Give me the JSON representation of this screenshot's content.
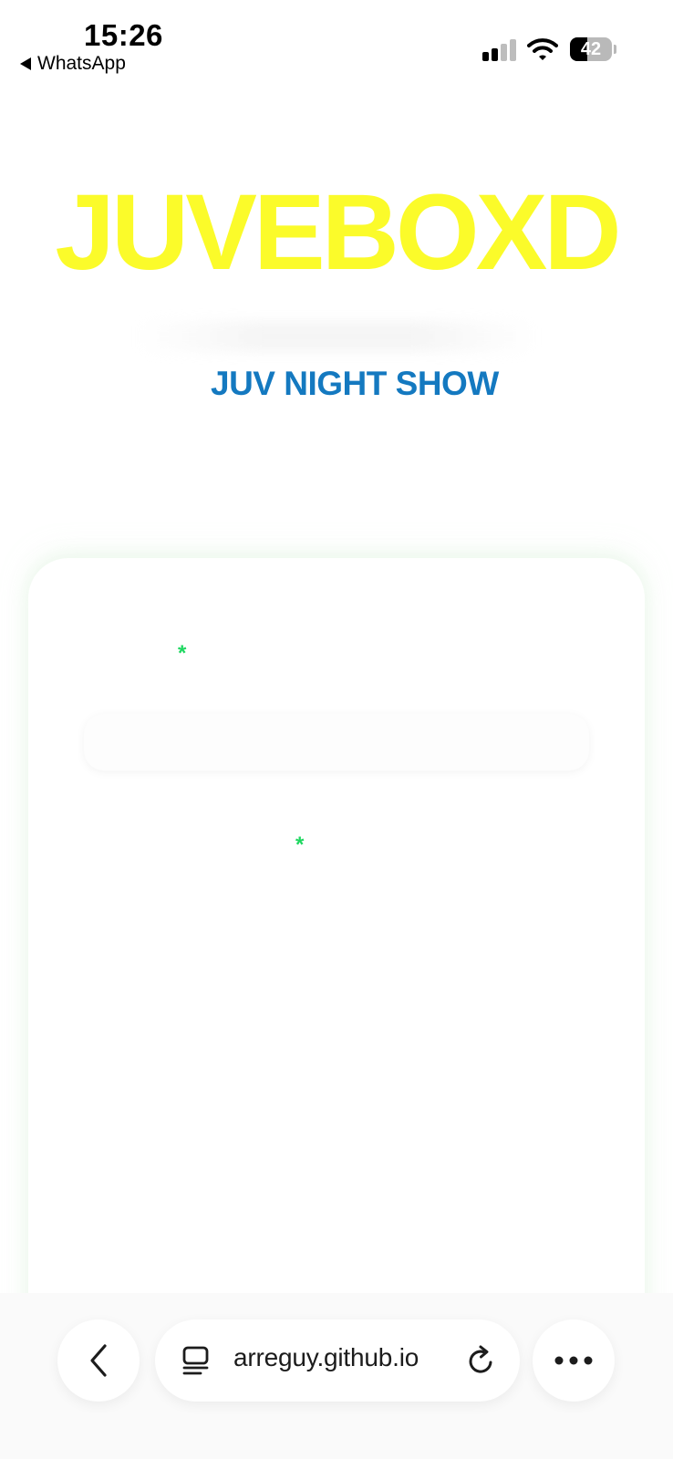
{
  "status_bar": {
    "time": "15:26",
    "back_app": "WhatsApp",
    "battery_level": "42",
    "battery_fraction": 0.42,
    "icons": [
      "signal-icon",
      "wifi-icon",
      "battery-icon"
    ]
  },
  "hero": {
    "title": "JUVEBOXD",
    "title_color": "#fbfb2a",
    "link_label": "JUV NIGHT SHOW",
    "link_color": "#1479c0"
  },
  "form": {
    "required_marker": "*",
    "marker_color": "#1ed760",
    "input_value": ""
  },
  "browser": {
    "url": "arreguy.github.io",
    "icons": [
      "back-chevron-icon",
      "tabs-icon",
      "reload-icon",
      "more-icon"
    ]
  }
}
